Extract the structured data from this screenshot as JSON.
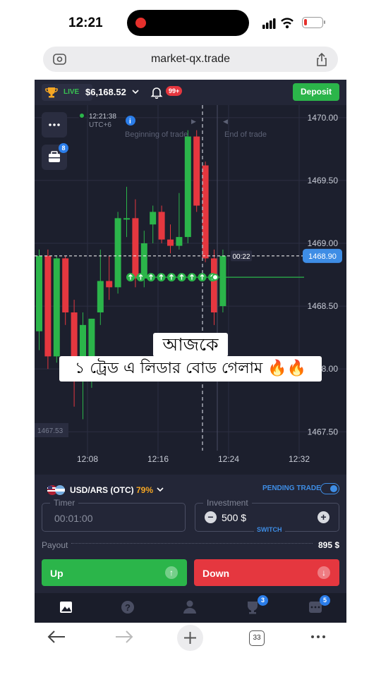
{
  "status_bar": {
    "time": "12:21"
  },
  "browser": {
    "url": "market-qx.trade",
    "tabs_count": "33"
  },
  "header": {
    "account_mode": "LIVE",
    "balance": "$6,168.52",
    "notifications": "99+",
    "deposit_label": "Deposit"
  },
  "chart": {
    "clock": "12:21:38",
    "timezone": "UTC+6",
    "beginning_label": "Beginning of trade",
    "end_label": "End of trade",
    "countdown": "00:22",
    "current_price": "1468.90",
    "low_price_tag": "1467.53",
    "briefcase_badge": "8",
    "menu_icon": "more-dots-icon",
    "accent_green": "#2bb54a",
    "accent_red": "#e5373f"
  },
  "chart_data": {
    "type": "candlestick",
    "y_ticks": [
      "1470.00",
      "1469.50",
      "1469.00",
      "1468.50",
      "1468.00",
      "1467.50"
    ],
    "x_ticks": [
      "12:08",
      "12:16",
      "12:24",
      "12:32"
    ],
    "ylim": [
      1467.35,
      1470.1
    ],
    "candles": [
      {
        "o": 1468.3,
        "h": 1468.95,
        "l": 1468.15,
        "c": 1468.9
      },
      {
        "o": 1468.9,
        "h": 1468.95,
        "l": 1468.0,
        "c": 1468.1
      },
      {
        "o": 1468.1,
        "h": 1468.9,
        "l": 1468.05,
        "c": 1468.88
      },
      {
        "o": 1468.88,
        "h": 1468.9,
        "l": 1468.35,
        "c": 1468.45
      },
      {
        "o": 1468.45,
        "h": 1468.55,
        "l": 1467.7,
        "c": 1467.95
      },
      {
        "o": 1467.95,
        "h": 1468.45,
        "l": 1467.6,
        "c": 1468.35
      },
      {
        "o": 1467.98,
        "h": 1468.4,
        "l": 1467.85,
        "c": 1468.4
      },
      {
        "o": 1468.45,
        "h": 1468.95,
        "l": 1468.35,
        "c": 1468.7
      },
      {
        "o": 1468.7,
        "h": 1468.9,
        "l": 1468.55,
        "c": 1468.65
      },
      {
        "o": 1468.65,
        "h": 1469.25,
        "l": 1468.6,
        "c": 1469.2
      },
      {
        "o": 1469.2,
        "h": 1469.45,
        "l": 1469.05,
        "c": 1469.2
      },
      {
        "o": 1469.2,
        "h": 1469.35,
        "l": 1468.65,
        "c": 1468.72
      },
      {
        "o": 1468.72,
        "h": 1469.1,
        "l": 1468.65,
        "c": 1469.0
      },
      {
        "o": 1469.15,
        "h": 1469.3,
        "l": 1469.0,
        "c": 1469.25
      },
      {
        "o": 1469.25,
        "h": 1469.3,
        "l": 1469.0,
        "c": 1469.03
      },
      {
        "o": 1469.03,
        "h": 1469.15,
        "l": 1468.92,
        "c": 1468.98
      },
      {
        "o": 1468.98,
        "h": 1469.4,
        "l": 1468.95,
        "c": 1469.05
      },
      {
        "o": 1469.05,
        "h": 1469.9,
        "l": 1469.0,
        "c": 1469.85
      },
      {
        "o": 1469.85,
        "h": 1469.9,
        "l": 1469.25,
        "c": 1469.3
      },
      {
        "o": 1469.62,
        "h": 1469.65,
        "l": 1468.85,
        "c": 1468.88
      },
      {
        "o": 1468.88,
        "h": 1468.95,
        "l": 1468.35,
        "c": 1468.45
      },
      {
        "o": 1468.5,
        "h": 1468.95,
        "l": 1468.45,
        "c": 1468.9
      }
    ],
    "trade_level": 1468.73
  },
  "overlay_caption": {
    "line1": "আজকে",
    "line2": "১ ট্রেড এ লিডার বোড গেলাম 🔥🔥"
  },
  "trade_panel": {
    "asset": "USD/ARS (OTC)",
    "payout_pct": "79%",
    "pending_label": "PENDING TRADE",
    "timer_label": "Timer",
    "timer_value": "00:01:00",
    "investment_label": "Investment",
    "investment_value": "500 $",
    "switch_label": "SWITCH",
    "payout_label": "Payout",
    "payout_value": "895 $",
    "up_label": "Up",
    "down_label": "Down"
  },
  "app_nav": {
    "items": [
      "chart-icon",
      "help-icon",
      "profile-icon",
      "trophy-icon",
      "chat-icon"
    ],
    "trophy_badge": "3",
    "chat_badge": "5"
  }
}
